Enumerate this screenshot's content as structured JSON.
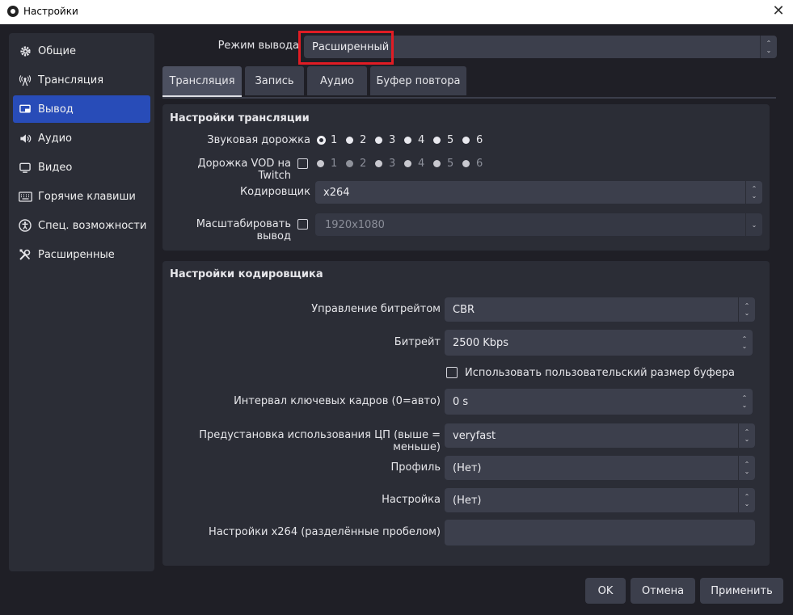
{
  "window": {
    "title": "Настройки",
    "close_glyph": "✕"
  },
  "sidebar": {
    "items": [
      {
        "label": "Общие",
        "icon": "gear-icon",
        "active": false
      },
      {
        "label": "Трансляция",
        "icon": "broadcast-icon",
        "active": false
      },
      {
        "label": "Вывод",
        "icon": "output-icon",
        "active": true
      },
      {
        "label": "Аудио",
        "icon": "speaker-icon",
        "active": false
      },
      {
        "label": "Видео",
        "icon": "monitor-icon",
        "active": false
      },
      {
        "label": "Горячие клавиши",
        "icon": "keyboard-icon",
        "active": false
      },
      {
        "label": "Спец. возможности",
        "icon": "accessibility-icon",
        "active": false
      },
      {
        "label": "Расширенные",
        "icon": "tools-icon",
        "active": false
      }
    ]
  },
  "output_mode": {
    "label": "Режим вывода",
    "value": "Расширенный"
  },
  "tabs": [
    {
      "label": "Трансляция",
      "active": true
    },
    {
      "label": "Запись",
      "active": false
    },
    {
      "label": "Аудио",
      "active": false
    },
    {
      "label": "Буфер повтора",
      "active": false
    }
  ],
  "stream_settings": {
    "title": "Настройки трансляции",
    "audio_track": {
      "label": "Звуковая дорожка",
      "options": [
        "1",
        "2",
        "3",
        "4",
        "5",
        "6"
      ],
      "selected": "1"
    },
    "twitch_vod": {
      "label": "Дорожка VOD на Twitch",
      "options": [
        "1",
        "2",
        "3",
        "4",
        "5",
        "6"
      ],
      "selected": "2",
      "checked": false
    },
    "encoder": {
      "label": "Кодировщик",
      "value": "x264"
    },
    "rescale": {
      "label": "Масштабировать вывод",
      "value": "1920x1080",
      "checked": false
    }
  },
  "encoder_settings": {
    "title": "Настройки кодировщика",
    "rate_control": {
      "label": "Управление битрейтом",
      "value": "CBR"
    },
    "bitrate": {
      "label": "Битрейт",
      "value": "2500 Kbps"
    },
    "custom_buffer": {
      "label": "Использовать пользовательский размер буфера",
      "checked": false
    },
    "keyframe": {
      "label": "Интервал ключевых кадров (0=авто)",
      "value": "0 s"
    },
    "cpu_preset": {
      "label": "Предустановка использования ЦП (выше = меньше)",
      "value": "veryfast"
    },
    "profile": {
      "label": "Профиль",
      "value": "(Нет)"
    },
    "tune": {
      "label": "Настройка",
      "value": "(Нет)"
    },
    "x264_opts": {
      "label": "Настройки x264 (разделённые пробелом)",
      "value": ""
    }
  },
  "buttons": {
    "ok": "OK",
    "cancel": "Отмена",
    "apply": "Применить"
  },
  "colors": {
    "accent": "#284cb8",
    "highlight": "#e11c24"
  }
}
